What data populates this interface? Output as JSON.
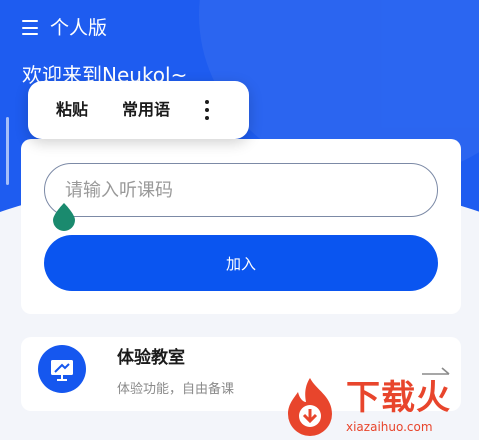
{
  "header": {
    "menu_icon": "hamburger-menu-icon",
    "edition_label": "个人版",
    "welcome_text": "欢迎来到Neukol~"
  },
  "context_menu": {
    "paste_label": "粘贴",
    "phrases_label": "常用语",
    "more_icon": "vertical-dots-icon"
  },
  "join_card": {
    "code_input": {
      "value": "",
      "placeholder": "请输入听课码"
    },
    "join_label": "加入"
  },
  "trial": {
    "title": "体验教室",
    "subtitle": "体验功能，自由备课",
    "icon": "presentation-board-icon",
    "arrow_icon": "arrow-right-icon"
  },
  "watermark": {
    "title": "下载火",
    "url": "xiazaihuo.com"
  },
  "colors": {
    "primary": "#1e5cf0",
    "button": "#0a55f0",
    "handle": "#1a8a6e",
    "watermark": "#e8452c"
  }
}
